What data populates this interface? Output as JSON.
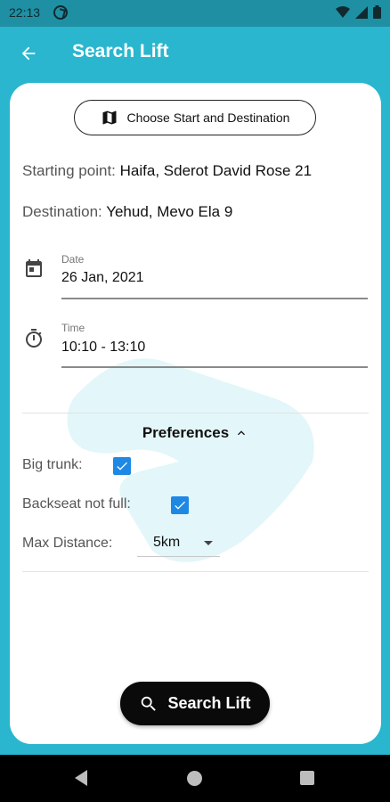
{
  "status_bar": {
    "time": "22:13"
  },
  "app_bar": {
    "title": "Search Lift"
  },
  "choose_button": {
    "label": "Choose Start and Destination"
  },
  "starting_point": {
    "label": "Starting point:",
    "value": "Haifa, Sderot David Rose 21"
  },
  "destination": {
    "label": "Destination:",
    "value": "Yehud, Mevo Ela 9"
  },
  "date_field": {
    "label": "Date",
    "value": "26 Jan, 2021"
  },
  "time_field": {
    "label": "Time",
    "value": "10:10 - 13:10"
  },
  "preferences": {
    "title": "Preferences",
    "big_trunk": {
      "label": "Big trunk:",
      "checked": true
    },
    "backseat": {
      "label": "Backseat not full:",
      "checked": true
    },
    "max_distance": {
      "label": "Max Distance:",
      "selected": "5km"
    }
  },
  "search_button": {
    "label": "Search Lift"
  },
  "colors": {
    "primary": "#29B6CE",
    "status_bar": "#1F8FA3",
    "checkbox": "#1E88E5",
    "button": "#0A0A0A"
  }
}
